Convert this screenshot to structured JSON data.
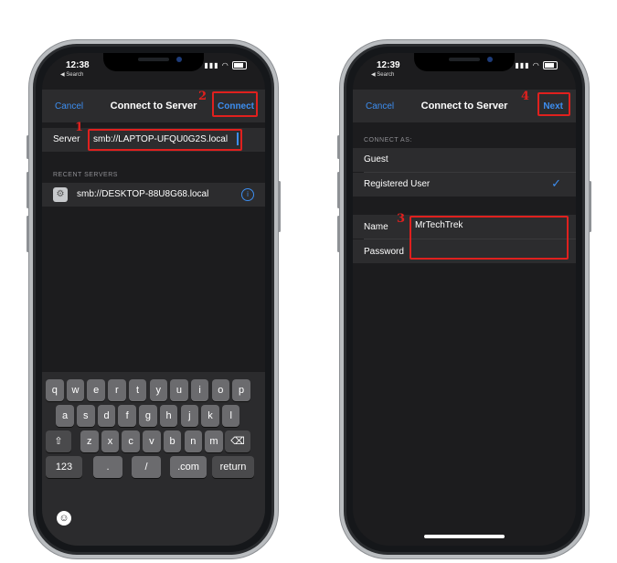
{
  "left": {
    "status": {
      "time": "12:38",
      "back": "◀ Search"
    },
    "nav": {
      "cancel": "Cancel",
      "title": "Connect to Server",
      "connect": "Connect"
    },
    "server": {
      "label": "Server",
      "value": "smb://LAPTOP-UFQU0G2S.local"
    },
    "recent": {
      "heading": "RECENT SERVERS",
      "item": "smb://DESKTOP-88U8G68.local"
    },
    "keyboard": {
      "row1": [
        "q",
        "w",
        "e",
        "r",
        "t",
        "y",
        "u",
        "i",
        "o",
        "p"
      ],
      "row2": [
        "a",
        "s",
        "d",
        "f",
        "g",
        "h",
        "j",
        "k",
        "l"
      ],
      "row3": [
        "z",
        "x",
        "c",
        "v",
        "b",
        "n",
        "m"
      ],
      "row4": [
        "123",
        ".",
        "/",
        ".com",
        "return"
      ]
    },
    "annotations": {
      "one": "1",
      "two": "2"
    }
  },
  "right": {
    "status": {
      "time": "12:39",
      "back": "◀ Search"
    },
    "nav": {
      "cancel": "Cancel",
      "title": "Connect to Server",
      "next": "Next"
    },
    "connect_as": {
      "heading": "CONNECT AS:",
      "guest": "Guest",
      "registered": "Registered User"
    },
    "name": {
      "label": "Name",
      "value": "MrTechTrek"
    },
    "password": {
      "label": "Password",
      "value": ""
    },
    "annotations": {
      "three": "3",
      "four": "4"
    }
  },
  "colors": {
    "accent": "#3d8ef0",
    "annotation": "#e0201e",
    "screen_bg": "#1c1c1e",
    "cell_bg": "#2c2c2e"
  }
}
